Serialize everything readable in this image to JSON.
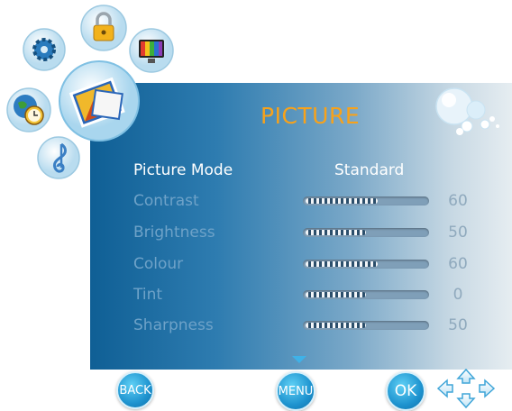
{
  "menu": {
    "title": "PICTURE",
    "rows": [
      {
        "label": "Picture Mode",
        "value": "Standard"
      },
      {
        "label": "Contrast",
        "level": 0.6,
        "number": "60"
      },
      {
        "label": "Brightness",
        "level": 0.5,
        "number": "50"
      },
      {
        "label": "Colour",
        "level": 0.6,
        "number": "60"
      },
      {
        "label": "Tint",
        "level": 0.5,
        "number": "0"
      },
      {
        "label": "Sharpness",
        "level": 0.5,
        "number": "50"
      }
    ]
  },
  "buttons": {
    "back": "BACK",
    "menu": "MENU",
    "ok": "OK"
  },
  "icons": {
    "nav": [
      "lock-icon",
      "gear-icon",
      "tv-icon",
      "picture-icon",
      "clock-globe-icon",
      "music-note-icon"
    ],
    "dpad": "dpad-arrows-icon"
  },
  "colors": {
    "title": "#f7a21b",
    "panel_start": "#0f5f95",
    "panel_end": "#e6edf1",
    "accent": "#1e93cf"
  }
}
